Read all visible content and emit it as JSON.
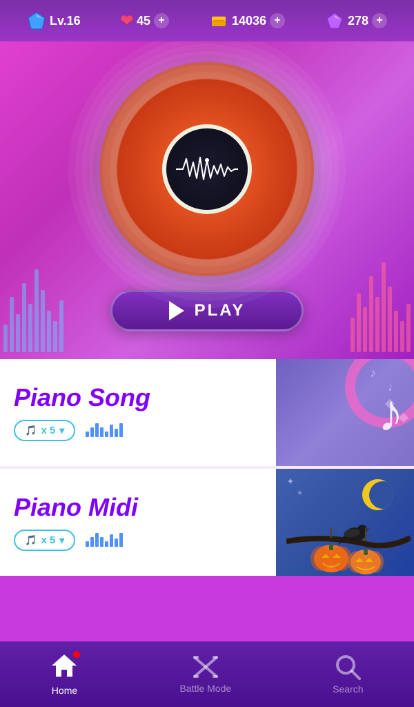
{
  "topbar": {
    "level": "Lv.16",
    "hearts": "45",
    "coins": "14036",
    "gems": "278"
  },
  "hero": {
    "play_label": "PLAY"
  },
  "cards": [
    {
      "title": "Piano Song",
      "note_count": "x 5",
      "type": "piano_song"
    },
    {
      "title": "Piano Midi",
      "note_count": "x 5",
      "type": "piano_midi"
    }
  ],
  "bottomnav": [
    {
      "label": "Home",
      "active": true
    },
    {
      "label": "Battle Mode",
      "active": false
    },
    {
      "label": "Search",
      "active": false
    }
  ]
}
